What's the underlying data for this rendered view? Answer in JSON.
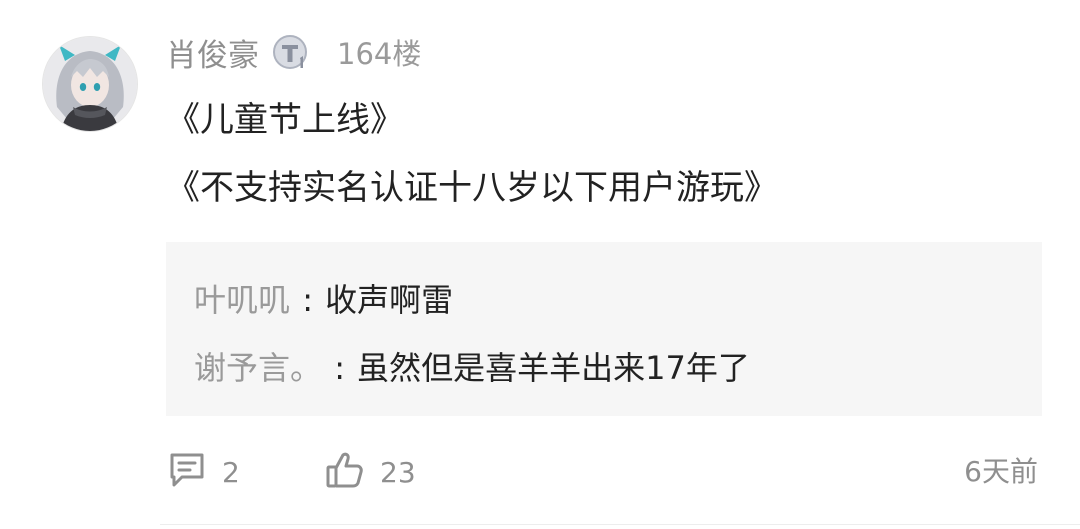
{
  "comment": {
    "username": "肖俊豪",
    "badge_icon": "t1-level-badge-icon",
    "floor": "164楼",
    "lines": [
      "《儿童节上线》",
      "《不支持实名认证十八岁以下用户游玩》"
    ]
  },
  "replies": [
    {
      "user": "叶叽叽",
      "separator": ":",
      "text": "收声啊雷"
    },
    {
      "user": "谢予言。",
      "separator": ":",
      "text": "虽然但是喜羊羊出来17年了"
    }
  ],
  "footer": {
    "comment_icon": "comment-bubble-icon",
    "comment_count": "2",
    "like_icon": "thumbs-up-icon",
    "like_count": "23",
    "timestamp": "6天前"
  },
  "colors": {
    "username": "#8f8f8f",
    "body_text": "#222222",
    "reply_background": "#f6f6f6"
  }
}
